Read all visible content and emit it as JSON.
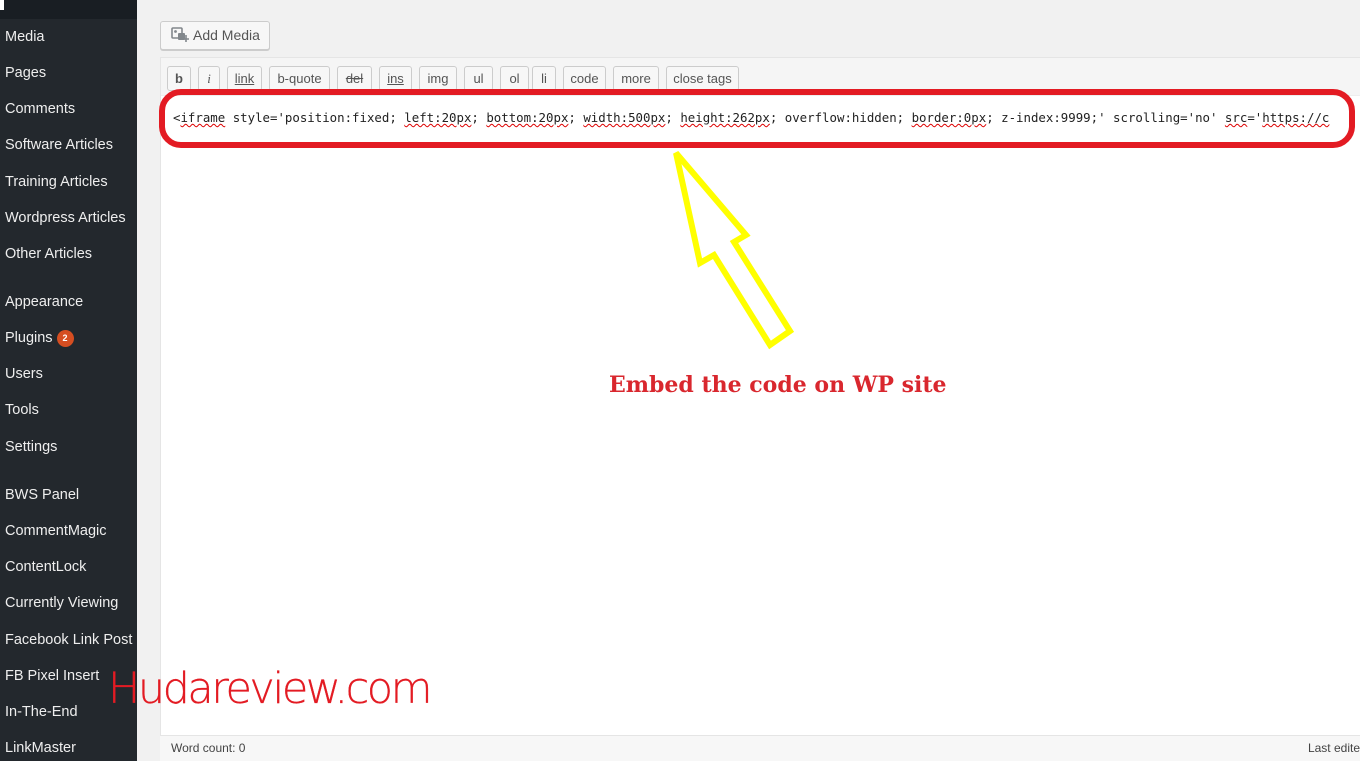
{
  "sidebar": {
    "items": [
      {
        "label": "Media"
      },
      {
        "label": "Pages"
      },
      {
        "label": "Comments"
      },
      {
        "label": "Software Articles"
      },
      {
        "label": "Training Articles"
      },
      {
        "label": "Wordpress Articles"
      },
      {
        "label": "Other Articles"
      },
      {
        "label": "Appearance"
      },
      {
        "label": "Plugins",
        "badge": "2"
      },
      {
        "label": "Users"
      },
      {
        "label": "Tools"
      },
      {
        "label": "Settings"
      },
      {
        "label": "BWS Panel"
      },
      {
        "label": "CommentMagic"
      },
      {
        "label": "ContentLock"
      },
      {
        "label": "Currently Viewing"
      },
      {
        "label": "Facebook Link Post"
      },
      {
        "label": "FB Pixel Insert"
      },
      {
        "label": "In-The-End"
      },
      {
        "label": "LinkMaster"
      }
    ]
  },
  "editor": {
    "add_media_label": "Add Media",
    "toolbar": [
      "b",
      "i",
      "link",
      "b-quote",
      "del",
      "ins",
      "img",
      "ul",
      "ol",
      "li",
      "code",
      "more",
      "close tags"
    ],
    "code": {
      "parts": [
        "<",
        "iframe",
        " style='position:fixed; ",
        "left:20px",
        "; ",
        "bottom:20px",
        "; ",
        "width:500px",
        "; ",
        "height:262px",
        "; overflow:hidden; ",
        "border:0px",
        "; z-index:9999;' scrolling='no' ",
        "src",
        "='",
        "https://c"
      ]
    },
    "word_count": "Word count: 0",
    "last_edited": "Last edite"
  },
  "annotation": {
    "text": "Embed the code on WP site",
    "watermark": "Hudareview.com",
    "colors": {
      "highlight": "#e31b23",
      "arrow": "#ffff00"
    }
  }
}
